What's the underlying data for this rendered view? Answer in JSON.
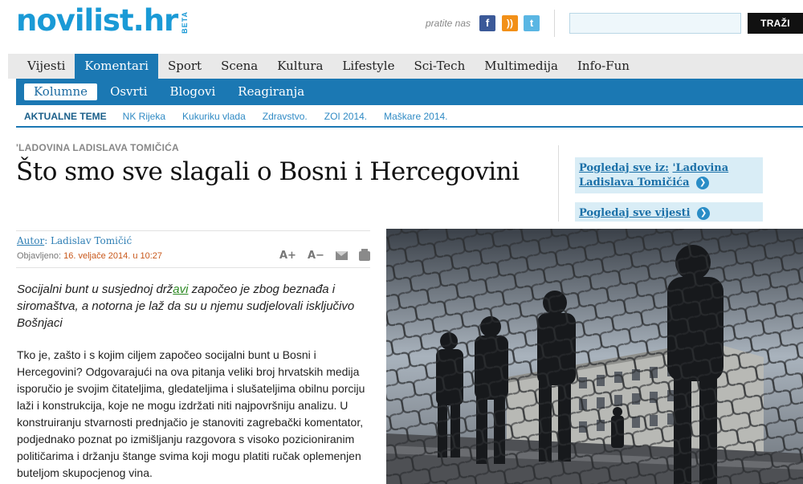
{
  "header": {
    "logo": "novilist.hr",
    "beta": "BETA",
    "follow_label": "pratite nas",
    "social": {
      "facebook": "f",
      "rss": "))",
      "twitter": "t"
    },
    "search": {
      "value": "",
      "placeholder": "",
      "button": "TRAŽI"
    }
  },
  "main_nav": [
    {
      "label": "Vijesti"
    },
    {
      "label": "Komentari",
      "active": true
    },
    {
      "label": "Sport"
    },
    {
      "label": "Scena"
    },
    {
      "label": "Kultura"
    },
    {
      "label": "Lifestyle"
    },
    {
      "label": "Sci-Tech"
    },
    {
      "label": "Multimedija"
    },
    {
      "label": "Info-Fun"
    }
  ],
  "sub_nav": [
    {
      "label": "Kolumne",
      "active": true
    },
    {
      "label": "Osvrti"
    },
    {
      "label": "Blogovi"
    },
    {
      "label": "Reagiranja"
    }
  ],
  "topics": {
    "label": "AKTUALNE TEME",
    "items": [
      "NK Rijeka",
      "Kukuriku vlada",
      "Zdravstvo.",
      "ZOI 2014.",
      "Maškare 2014."
    ]
  },
  "article": {
    "kicker": "'LADOVINA LADISLAVA TOMIČIĆA",
    "title": "Što smo sve slagali o Bosni i Hercegovini",
    "author_label": "Autor",
    "author_name": "Ladislav Tomičić",
    "published_label": "Objavljeno:",
    "published_date": "16. veljače 2014. u 10:27",
    "tools": {
      "font_up": "A+",
      "font_down": "A−"
    },
    "lead_before": "Socijalni bunt u susjednoj drž",
    "lead_link": "avi",
    "lead_after": " započeo je zbog beznađa i siromaštva, a notorna je laž da su u njemu sudjelovali isključivo Bošnjaci",
    "body": "Tko je, zašto i s kojim ciljem započeo socijalni bunt u Bosni i Hercegovini? Odgovarajući na ova pitanja veliki broj hrvatskih medija isporučio je svojim čitateljima, gledateljima i slušateljima obilnu porciju laži i konstrukcija, koje ne mogu izdržati niti najpovršniju analizu. U konstruiranju stvarnosti prednjačio je stanoviti zagrebački komentator, podjednako poznat po izmišljanju razgovora s visoko pozicioniranim političarima i držanju štange svima koji mogu platiti ručak oplemenjen buteljom skupocjenog vina."
  },
  "sidebar": {
    "view_all_from_label": "Pogledaj sve iz:",
    "view_all_from_target": "'Ladovina Ladislava Tomičića",
    "view_all_news": "Pogledaj sve vijesti"
  },
  "colors": {
    "brand": "#1a9ad6",
    "nav_active": "#1b78b3",
    "link": "#2f8ac4"
  }
}
